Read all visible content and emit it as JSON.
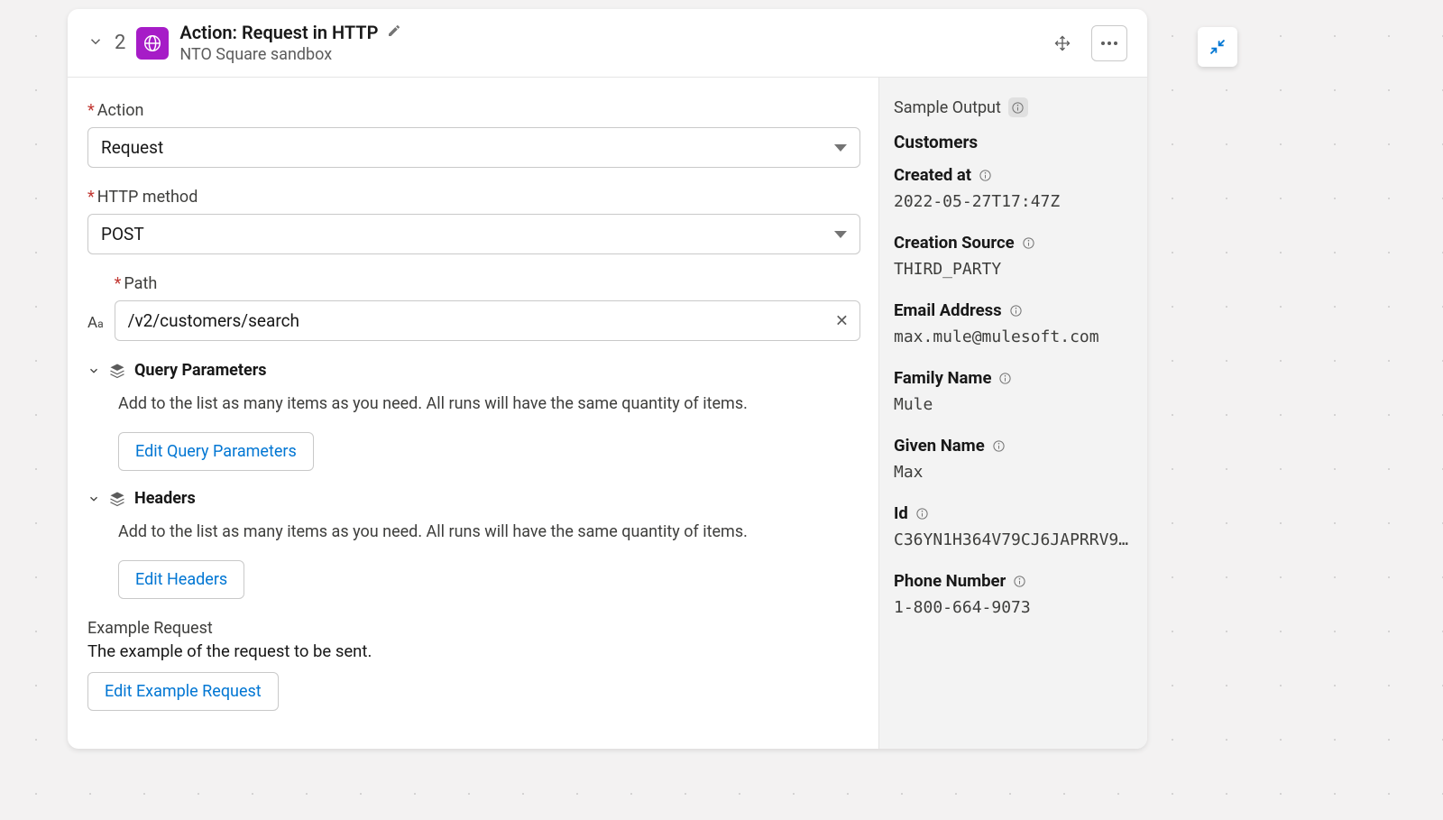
{
  "header": {
    "step_number": "2",
    "title": "Action: Request in HTTP",
    "subtitle": "NTO Square sandbox"
  },
  "form": {
    "action": {
      "label": "Action",
      "value": "Request"
    },
    "http_method": {
      "label": "HTTP method",
      "value": "POST"
    },
    "path": {
      "label": "Path",
      "value": "/v2/customers/search"
    },
    "query_params": {
      "title": "Query Parameters",
      "desc": "Add to the list as many items as you need. All runs will have the same quantity of items.",
      "button": "Edit Query Parameters"
    },
    "headers": {
      "title": "Headers",
      "desc": "Add to the list as many items as you need. All runs will have the same quantity of items.",
      "button": "Edit Headers"
    },
    "example": {
      "label": "Example Request",
      "desc": "The example of the request to be sent.",
      "button": "Edit Example Request"
    }
  },
  "output": {
    "title": "Sample Output",
    "group": "Customers",
    "fields": [
      {
        "label": "Created at",
        "value": "2022-05-27T17:47Z"
      },
      {
        "label": "Creation Source",
        "value": "THIRD_PARTY"
      },
      {
        "label": "Email Address",
        "value": "max.mule@mulesoft.com"
      },
      {
        "label": "Family Name",
        "value": "Mule"
      },
      {
        "label": "Given Name",
        "value": "Max"
      },
      {
        "label": "Id",
        "value": "C36YN1H364V79CJ6JAPRRV9F…"
      },
      {
        "label": "Phone Number",
        "value": "1-800-664-9073"
      }
    ]
  }
}
